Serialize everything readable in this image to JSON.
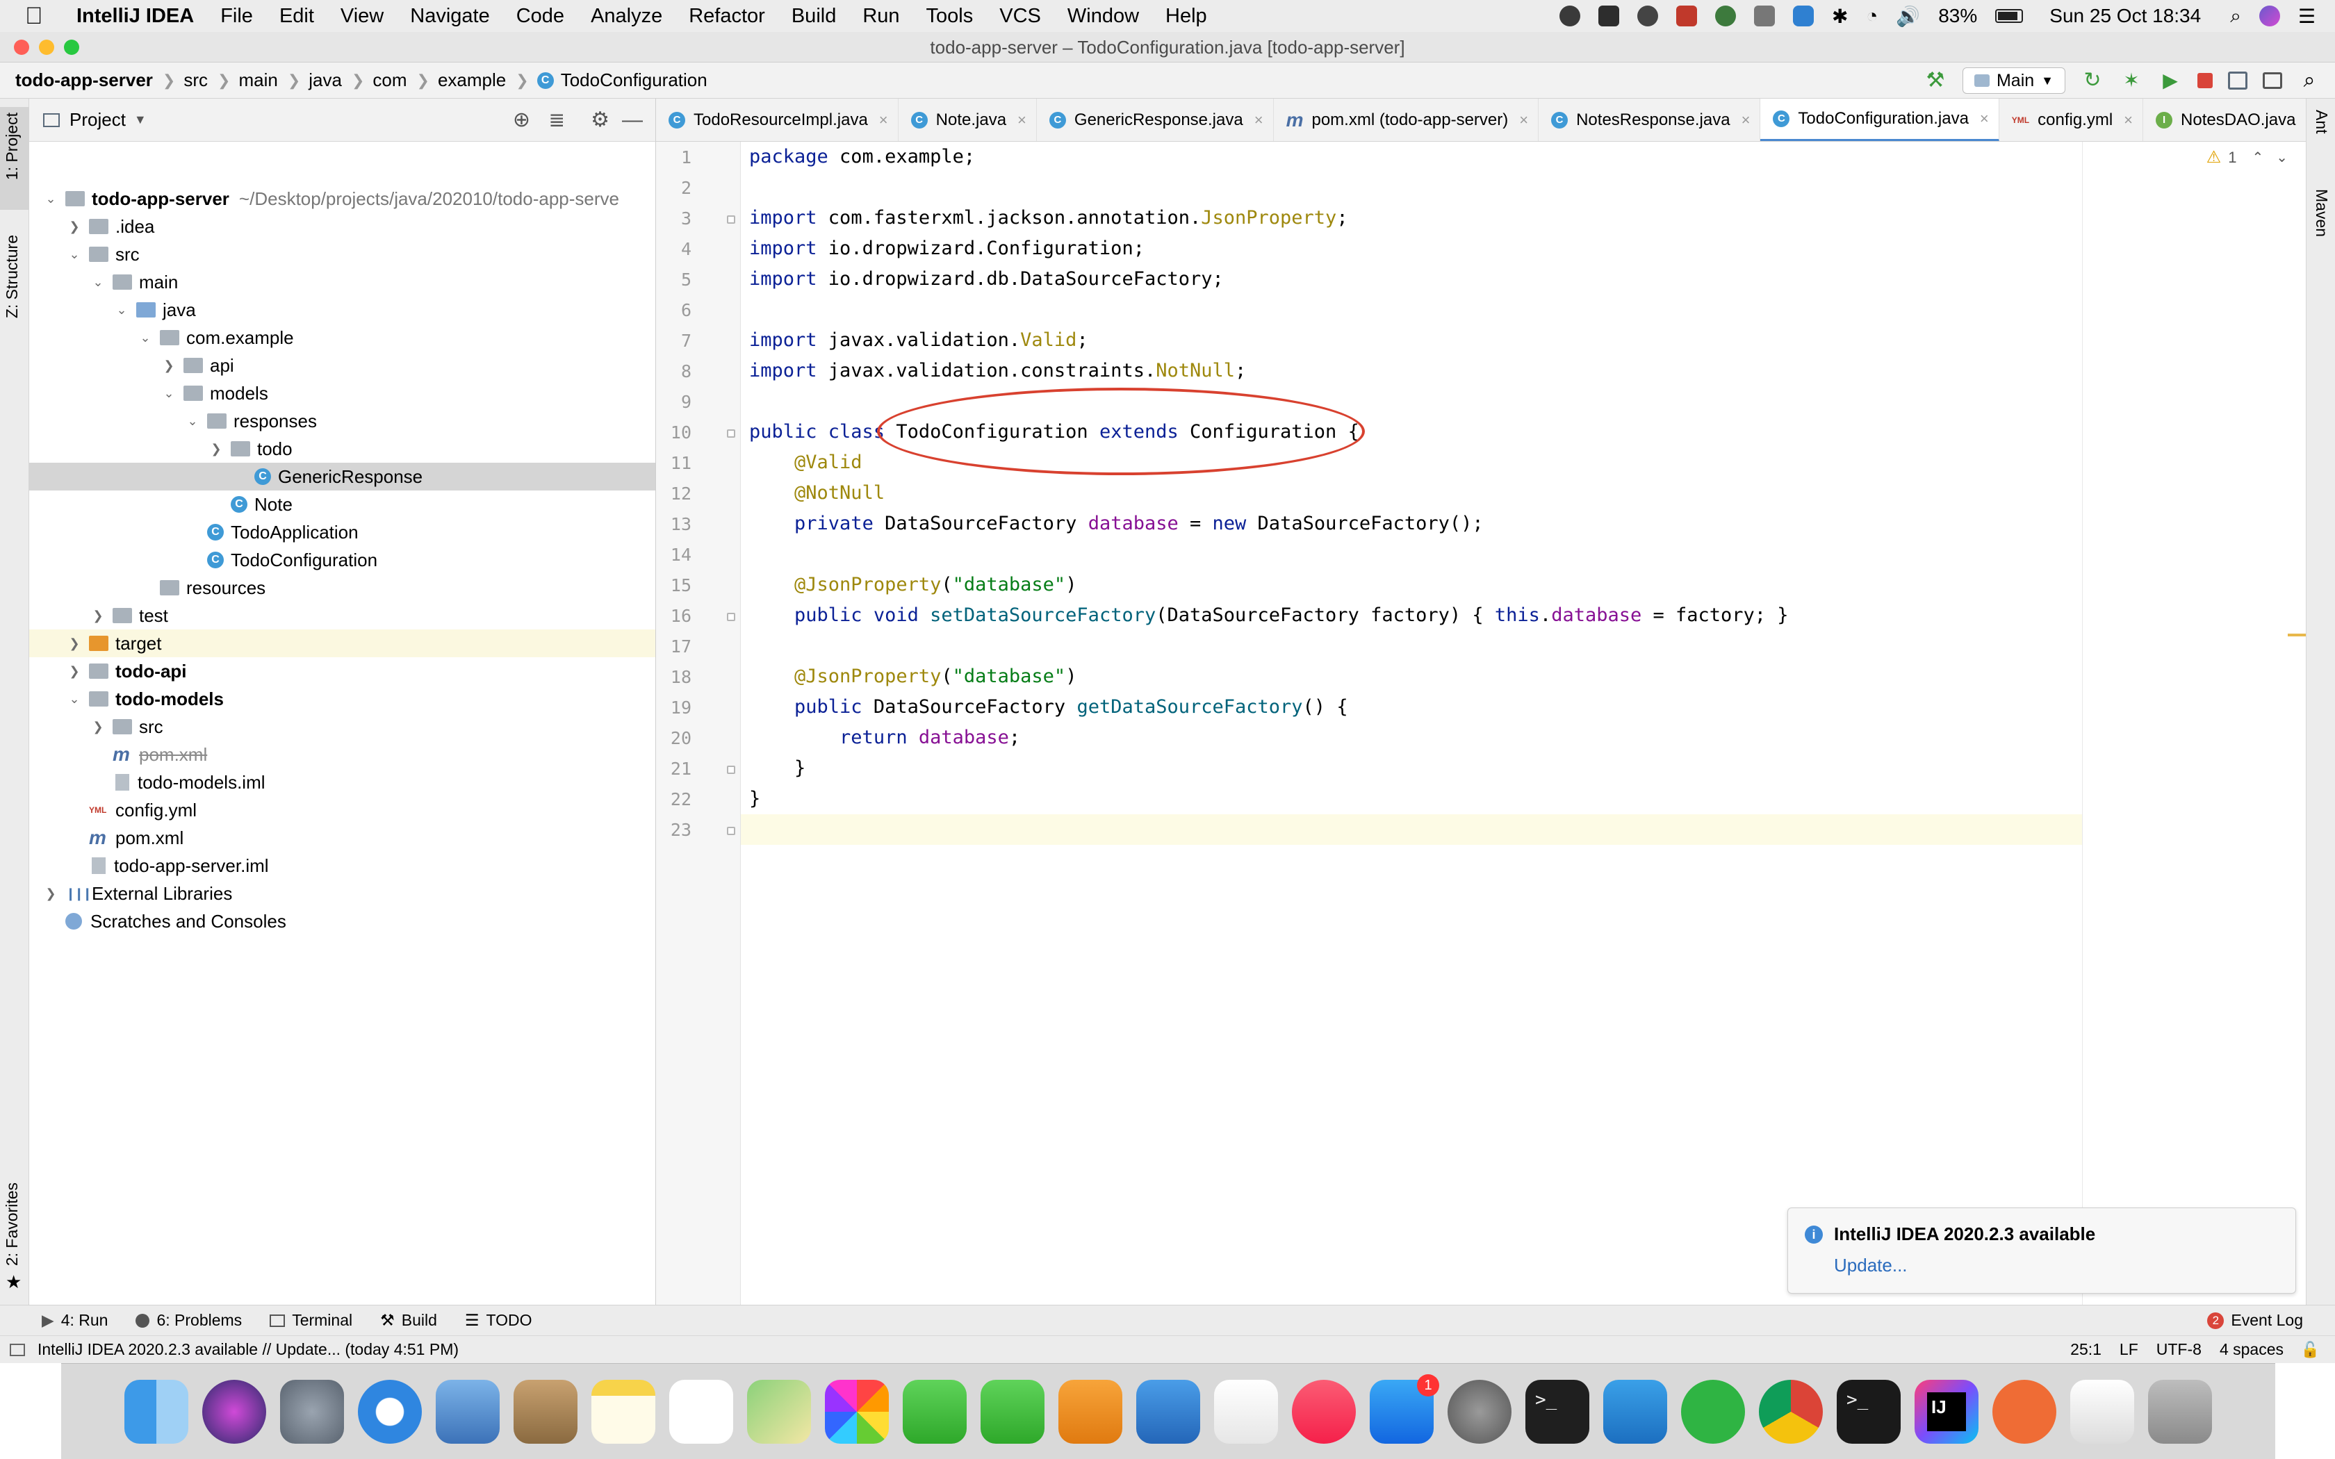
{
  "menubar": {
    "app_name": "IntelliJ IDEA",
    "items": [
      "File",
      "Edit",
      "View",
      "Navigate",
      "Code",
      "Analyze",
      "Refactor",
      "Build",
      "Run",
      "Tools",
      "VCS",
      "Window",
      "Help"
    ],
    "battery": "83%",
    "datetime": "Sun 25 Oct  18:34"
  },
  "window": {
    "title": "todo-app-server – TodoConfiguration.java [todo-app-server]"
  },
  "navbar": {
    "breadcrumbs": [
      "todo-app-server",
      "src",
      "main",
      "java",
      "com",
      "example",
      "TodoConfiguration"
    ],
    "run_config": "Main"
  },
  "toolstrip": {
    "left_top": "1: Project",
    "left_mid": "Z: Structure",
    "left_bottom": "2: Favorites",
    "right_top": "Ant",
    "right_mid": "Maven"
  },
  "project_panel": {
    "title": "Project",
    "root_path": "~/Desktop/projects/java/202010/todo-app-serve",
    "tree": [
      {
        "label": "todo-app-server",
        "depth": 0,
        "expanded": true,
        "bold": true,
        "icon": "module-folder"
      },
      {
        "label": ".idea",
        "depth": 1,
        "expanded": false,
        "icon": "folder"
      },
      {
        "label": "src",
        "depth": 1,
        "expanded": true,
        "icon": "folder"
      },
      {
        "label": "main",
        "depth": 2,
        "expanded": true,
        "icon": "folder"
      },
      {
        "label": "java",
        "depth": 3,
        "expanded": true,
        "icon": "source-folder"
      },
      {
        "label": "com.example",
        "depth": 4,
        "expanded": true,
        "icon": "package"
      },
      {
        "label": "api",
        "depth": 5,
        "expanded": false,
        "icon": "package"
      },
      {
        "label": "models",
        "depth": 5,
        "expanded": true,
        "icon": "package"
      },
      {
        "label": "responses",
        "depth": 6,
        "expanded": true,
        "icon": "package"
      },
      {
        "label": "todo",
        "depth": 7,
        "expanded": false,
        "icon": "package"
      },
      {
        "label": "GenericResponse",
        "depth": 8,
        "icon": "class",
        "selected": true
      },
      {
        "label": "Note",
        "depth": 7,
        "icon": "class"
      },
      {
        "label": "TodoApplication",
        "depth": 6,
        "icon": "class"
      },
      {
        "label": "TodoConfiguration",
        "depth": 6,
        "icon": "class"
      },
      {
        "label": "resources",
        "depth": 4,
        "icon": "resources-folder"
      },
      {
        "label": "test",
        "depth": 2,
        "expanded": false,
        "icon": "folder"
      },
      {
        "label": "target",
        "depth": 1,
        "expanded": false,
        "icon": "excluded-folder",
        "highlight": true
      },
      {
        "label": "todo-api",
        "depth": 1,
        "expanded": false,
        "bold": true,
        "icon": "module-folder"
      },
      {
        "label": "todo-models",
        "depth": 1,
        "expanded": true,
        "bold": true,
        "icon": "module-folder"
      },
      {
        "label": "src",
        "depth": 2,
        "expanded": false,
        "icon": "folder"
      },
      {
        "label": "pom.xml",
        "depth": 2,
        "icon": "maven",
        "strike": true
      },
      {
        "label": "todo-models.iml",
        "depth": 2,
        "icon": "iml"
      },
      {
        "label": "config.yml",
        "depth": 1,
        "icon": "yml"
      },
      {
        "label": "pom.xml",
        "depth": 1,
        "icon": "maven"
      },
      {
        "label": "todo-app-server.iml",
        "depth": 1,
        "icon": "iml"
      },
      {
        "label": "External Libraries",
        "depth": 0,
        "expanded": false,
        "icon": "libraries"
      },
      {
        "label": "Scratches and Consoles",
        "depth": 0,
        "icon": "scratches"
      }
    ]
  },
  "tabs": [
    {
      "label": "TodoResourceImpl.java",
      "icon": "class"
    },
    {
      "label": "Note.java",
      "icon": "class"
    },
    {
      "label": "GenericResponse.java",
      "icon": "class"
    },
    {
      "label": "pom.xml (todo-app-server)",
      "icon": "maven"
    },
    {
      "label": "NotesResponse.java",
      "icon": "class"
    },
    {
      "label": "TodoConfiguration.java",
      "icon": "class",
      "active": true
    },
    {
      "label": "config.yml",
      "icon": "yml"
    },
    {
      "label": "NotesDAO.java",
      "icon": "interface"
    }
  ],
  "editor": {
    "warning_count": "1",
    "lines": [
      [
        {
          "t": "package",
          "c": "kw"
        },
        {
          "t": " com.example;"
        }
      ],
      [],
      [
        {
          "t": "import",
          "c": "kw"
        },
        {
          "t": " com.fasterxml.jackson.annotation."
        },
        {
          "t": "JsonProperty",
          "c": "an"
        },
        {
          "t": ";"
        }
      ],
      [
        {
          "t": "import",
          "c": "kw"
        },
        {
          "t": " io.dropwizard.Configuration;"
        }
      ],
      [
        {
          "t": "import",
          "c": "kw"
        },
        {
          "t": " io.dropwizard.db.DataSourceFactory;"
        }
      ],
      [],
      [
        {
          "t": "import",
          "c": "kw"
        },
        {
          "t": " javax.validation."
        },
        {
          "t": "Valid",
          "c": "an"
        },
        {
          "t": ";"
        }
      ],
      [
        {
          "t": "import",
          "c": "kw"
        },
        {
          "t": " javax.validation.constraints."
        },
        {
          "t": "NotNull",
          "c": "an"
        },
        {
          "t": ";"
        }
      ],
      [],
      [
        {
          "t": "public class",
          "c": "kw"
        },
        {
          "t": " TodoConfiguration "
        },
        {
          "t": "extends",
          "c": "kw"
        },
        {
          "t": " Configuration {"
        }
      ],
      [
        {
          "t": "    "
        },
        {
          "t": "@Valid",
          "c": "an"
        }
      ],
      [
        {
          "t": "    "
        },
        {
          "t": "@NotNull",
          "c": "an"
        }
      ],
      [
        {
          "t": "    "
        },
        {
          "t": "private",
          "c": "kw"
        },
        {
          "t": " DataSourceFactory "
        },
        {
          "t": "database",
          "c": "fd"
        },
        {
          "t": " = "
        },
        {
          "t": "new",
          "c": "kw"
        },
        {
          "t": " DataSourceFactory();"
        }
      ],
      [],
      [
        {
          "t": "    "
        },
        {
          "t": "@JsonProperty",
          "c": "an"
        },
        {
          "t": "("
        },
        {
          "t": "\"database\"",
          "c": "st"
        },
        {
          "t": ")"
        }
      ],
      [
        {
          "t": "    "
        },
        {
          "t": "public void",
          "c": "kw"
        },
        {
          "t": " "
        },
        {
          "t": "setDataSourceFactory",
          "c": "mt"
        },
        {
          "t": "(DataSourceFactory factory) { "
        },
        {
          "t": "this",
          "c": "kw"
        },
        {
          "t": "."
        },
        {
          "t": "database",
          "c": "fd"
        },
        {
          "t": " = factory; }"
        }
      ],
      [],
      [
        {
          "t": "    "
        },
        {
          "t": "@JsonProperty",
          "c": "an"
        },
        {
          "t": "("
        },
        {
          "t": "\"database\"",
          "c": "st"
        },
        {
          "t": ")"
        }
      ],
      [
        {
          "t": "    "
        },
        {
          "t": "public",
          "c": "kw"
        },
        {
          "t": " DataSourceFactory "
        },
        {
          "t": "getDataSourceFactory",
          "c": "mt"
        },
        {
          "t": "() {"
        }
      ],
      [
        {
          "t": "        "
        },
        {
          "t": "return",
          "c": "kw"
        },
        {
          "t": " "
        },
        {
          "t": "database",
          "c": "fd"
        },
        {
          "t": ";"
        }
      ],
      [
        {
          "t": "    }"
        }
      ],
      [
        {
          "t": "}"
        }
      ],
      []
    ],
    "current_line": 25
  },
  "notification": {
    "title": "IntelliJ IDEA 2020.2.3 available",
    "link": "Update..."
  },
  "bottom_tools": [
    "4: Run",
    "6: Problems",
    "Terminal",
    "Build",
    "TODO"
  ],
  "event_log": {
    "label": "Event Log",
    "count": "2"
  },
  "statusbar": {
    "message": "IntelliJ IDEA 2020.2.3 available // Update... (today 4:51 PM)",
    "position": "25:1",
    "line_sep": "LF",
    "encoding": "UTF-8",
    "indent": "4 spaces"
  },
  "dock": {
    "apps": [
      "finder",
      "siri",
      "launchpad",
      "safari",
      "mail",
      "contacts",
      "notes",
      "reminders",
      "maps",
      "photos",
      "messages",
      "facetime",
      "pages",
      "keynote",
      "numbers",
      "music",
      "app-store",
      "system-preferences",
      "terminal",
      "vscode",
      "evernote",
      "chrome",
      "iterm",
      "intellij",
      "postman",
      "documents",
      "trash"
    ],
    "app_store_badge": "1"
  }
}
